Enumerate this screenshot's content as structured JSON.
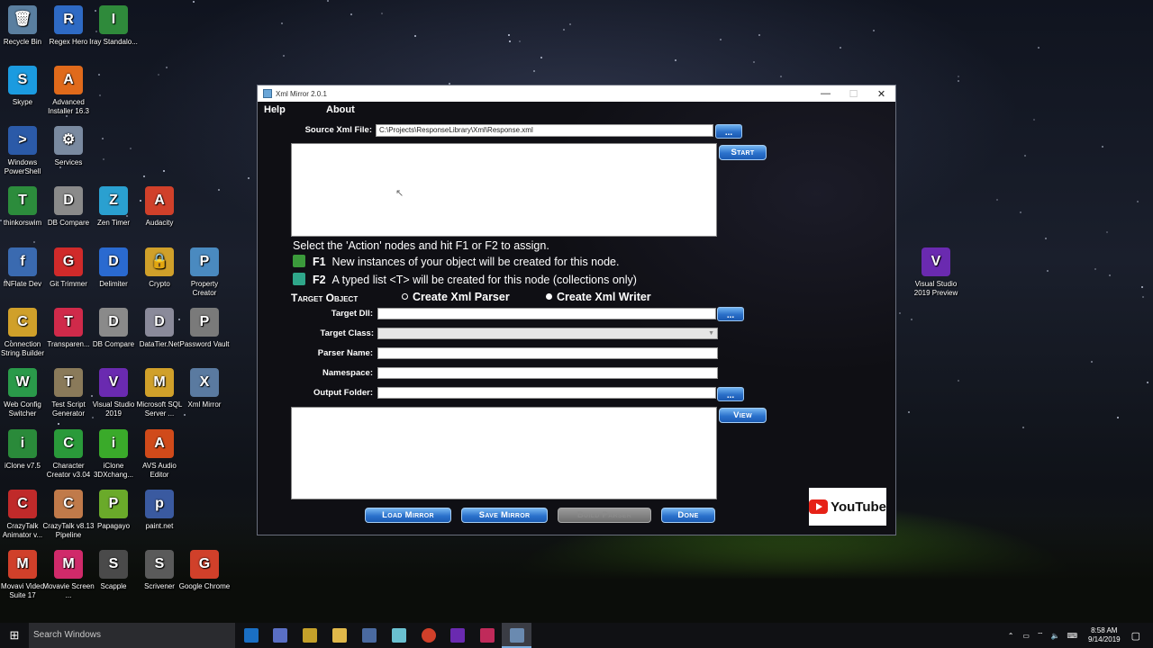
{
  "desktop": {
    "icons": [
      {
        "label": "Recycle Bin",
        "color": "#5a7fa0",
        "glyph": "🗑"
      },
      {
        "label": "Regex Hero",
        "color": "#2e6ac4",
        "glyph": "R"
      },
      {
        "label": "Iray Standalo...",
        "color": "#2f8a3b",
        "glyph": "I"
      },
      {
        "label": "Skype",
        "color": "#1b9be0",
        "glyph": "S"
      },
      {
        "label": "Advanced Installer 16.3",
        "color": "#e06a1b",
        "glyph": "A"
      },
      {
        "label": "Windows PowerShell",
        "color": "#2b5aa8",
        "glyph": ">"
      },
      {
        "label": "Services",
        "color": "#7a8aa0",
        "glyph": "⚙"
      },
      {
        "label": "thinkorswim",
        "color": "#2c8c3c",
        "glyph": "T"
      },
      {
        "label": "DB Compare",
        "color": "#8a8a8a",
        "glyph": "D"
      },
      {
        "label": "Zen Timer",
        "color": "#2aa0d0",
        "glyph": "Z"
      },
      {
        "label": "Audacity",
        "color": "#d0402a",
        "glyph": "A"
      },
      {
        "label": "fNFlate Dev",
        "color": "#3a6ab0",
        "glyph": "f"
      },
      {
        "label": "Git Trimmer",
        "color": "#d02a2a",
        "glyph": "G"
      },
      {
        "label": "Delimiter",
        "color": "#2a6ad0",
        "glyph": "D"
      },
      {
        "label": "Crypto",
        "color": "#d0a02a",
        "glyph": "🔒"
      },
      {
        "label": "Property Creator",
        "color": "#4a8ac0",
        "glyph": "P"
      },
      {
        "label": "Connection String Builder",
        "color": "#d0a02a",
        "glyph": "C"
      },
      {
        "label": "Transparen...",
        "color": "#d02a4a",
        "glyph": "T"
      },
      {
        "label": "DB Compare",
        "color": "#8a8a8a",
        "glyph": "D"
      },
      {
        "label": "DataTier.Net",
        "color": "#8a8a9a",
        "glyph": "D"
      },
      {
        "label": "Password Vault",
        "color": "#7a7a7a",
        "glyph": "P"
      },
      {
        "label": "Web Config Switcher",
        "color": "#2a9a4a",
        "glyph": "W"
      },
      {
        "label": "Test Script Generator",
        "color": "#8a7a5a",
        "glyph": "T"
      },
      {
        "label": "Visual Studio 2019",
        "color": "#6a2ab0",
        "glyph": "V"
      },
      {
        "label": "Microsoft SQL Server ...",
        "color": "#d0a02a",
        "glyph": "M"
      },
      {
        "label": "Xml Mirror",
        "color": "#5a7aa0",
        "glyph": "X"
      },
      {
        "label": "iClone v7.5",
        "color": "#2a8a3a",
        "glyph": "i"
      },
      {
        "label": "Character Creator v3.04",
        "color": "#2a9a3a",
        "glyph": "C"
      },
      {
        "label": "iClone 3DXchang...",
        "color": "#3aaa2a",
        "glyph": "i"
      },
      {
        "label": "AVS Audio Editor",
        "color": "#d04a1a",
        "glyph": "A"
      },
      {
        "label": "CrazyTalk Animator v...",
        "color": "#c02a2a",
        "glyph": "C"
      },
      {
        "label": "CrazyTalk v8.13 Pipeline",
        "color": "#c07a4a",
        "glyph": "C"
      },
      {
        "label": "Papagayo",
        "color": "#6aaa2a",
        "glyph": "P"
      },
      {
        "label": "paint.net",
        "color": "#3a5aa0",
        "glyph": "p"
      },
      {
        "label": "Movavi Video Suite 17",
        "color": "#d0402a",
        "glyph": "M"
      },
      {
        "label": "Movavie Screen ...",
        "color": "#d02a6a",
        "glyph": "M"
      },
      {
        "label": "Scapple",
        "color": "#4a4a4a",
        "glyph": "S"
      },
      {
        "label": "Scrivener",
        "color": "#5a5a5a",
        "glyph": "S"
      },
      {
        "label": "Google Chrome",
        "color": "#d0402a",
        "glyph": "G"
      },
      {
        "label": "Visual Studio 2019 Preview",
        "color": "#6a2ab0",
        "glyph": "V"
      }
    ]
  },
  "window": {
    "title": "Xml Mirror 2.0.1",
    "menu": {
      "help": "Help",
      "about": "About"
    },
    "source_label": "Source Xml File:",
    "source_value": "C:\\Projects\\ResponseLibrary\\Xml\\Response.xml",
    "dots": "...",
    "start": "Start",
    "instructions": "Select the 'Action' nodes and hit F1 or F2 to assign.",
    "f1_key": "F1",
    "f1_text": "New instances of your object will be created for this node.",
    "f2_key": "F2",
    "f2_text": "A typed list <T> will be created for this node (collections only)",
    "target_object_label": "Target Object",
    "radio_parser": "Create Xml Parser",
    "radio_writer": "Create Xml Writer",
    "target_dll_label": "Target Dll:",
    "target_class_label": "Target Class:",
    "parser_name_label": "Parser Name:",
    "namespace_label": "Namespace:",
    "output_folder_label": "Output Folder:",
    "view": "View",
    "load_mirror": "Load Mirror",
    "save_mirror": "Save Mirror",
    "build_parser": "Build Parser",
    "done": "Done"
  },
  "overlay": {
    "youtube": "YouTube"
  },
  "taskbar": {
    "search_placeholder": "Search Windows",
    "time": "8:58 AM",
    "date": "9/14/2019"
  }
}
